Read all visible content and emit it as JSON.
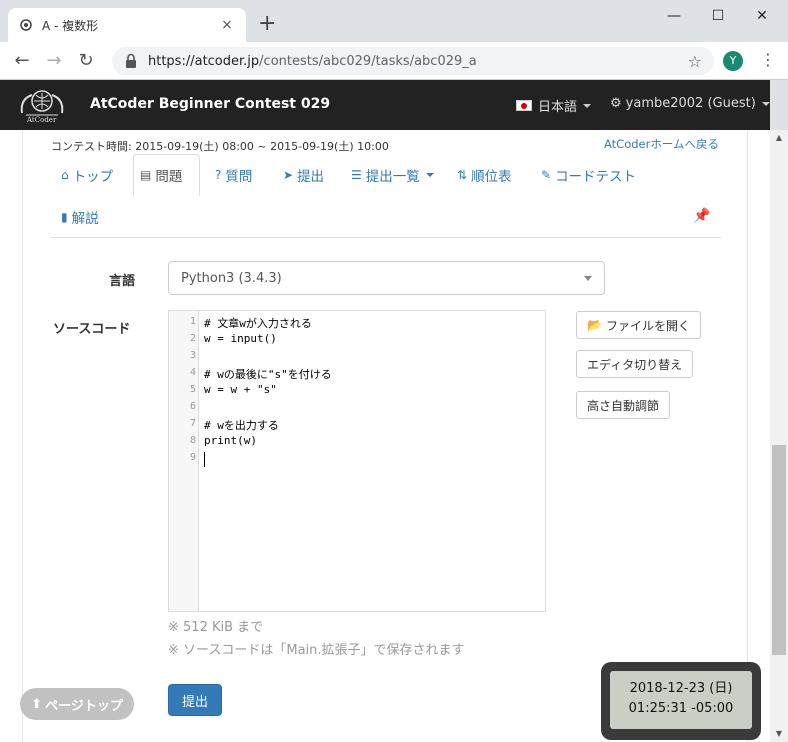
{
  "browser": {
    "tab_title": "A - 複数形",
    "tab_close": "×",
    "new_tab": "+",
    "win_min": "—",
    "win_max": "☐",
    "win_close": "✕",
    "url_host": "https://atcoder.jp",
    "url_path": "/contests/abc029/tasks/abc029_a",
    "avatar_letter": "Y"
  },
  "site": {
    "logo_text": "AtCoder",
    "contest_name": "AtCoder Beginner Contest 029",
    "language": "日本語",
    "user": "yambe2002 (Guest)"
  },
  "contest": {
    "time_label": "コンテスト時間: 2015-09-19(土) 08:00 ~ 2015-09-19(土) 10:00",
    "home_link": "AtCoderホームへ戻る"
  },
  "tabs": [
    {
      "label": "トップ",
      "icon": "⌂"
    },
    {
      "label": "問題",
      "icon": "▤"
    },
    {
      "label": "質問",
      "icon": "?"
    },
    {
      "label": "提出",
      "icon": "➤"
    },
    {
      "label": "提出一覧",
      "icon": "☰"
    },
    {
      "label": "順位表",
      "icon": "⇅"
    },
    {
      "label": "コードテスト",
      "icon": "✎"
    },
    {
      "label": "解説",
      "icon": "▮"
    }
  ],
  "form": {
    "language_label": "言語",
    "language_value": "Python3 (3.4.3)",
    "source_label": "ソースコード",
    "open_file": "ファイルを開く",
    "switch_editor": "エディタ切り替え",
    "auto_height": "高さ自動調節",
    "note_size": "※ 512 KiB まで",
    "note_save": "※ ソースコードは「Main.拡張子」で保存されます",
    "submit": "提出",
    "page_top": "ページトップ"
  },
  "code_lines": [
    {
      "n": "1",
      "text": "# 文章wが入力される"
    },
    {
      "n": "2",
      "text": "w = input()"
    },
    {
      "n": "3",
      "text": ""
    },
    {
      "n": "4",
      "text": "# wの最後に\"s\"を付ける"
    },
    {
      "n": "5",
      "text": "w = w + \"s\""
    },
    {
      "n": "6",
      "text": ""
    },
    {
      "n": "7",
      "text": "# wを出力する"
    },
    {
      "n": "8",
      "text": "print(w)"
    },
    {
      "n": "9",
      "text": ""
    }
  ],
  "clock": {
    "date": "2018-12-23 (日)",
    "time": "01:25:31 -05:00"
  },
  "colors": {
    "navbar": "#222222",
    "link": "#337ab7",
    "submit": "#337ab7"
  }
}
